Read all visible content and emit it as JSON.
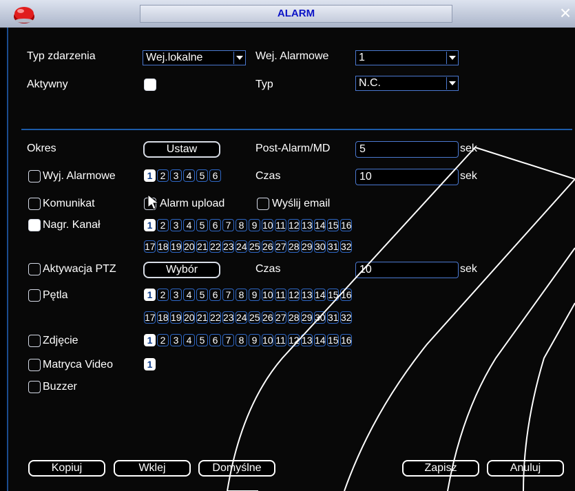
{
  "title": "ALARM",
  "row1": {
    "event_type_label": "Typ zdarzenia",
    "event_type_value": "Wej.lokalne",
    "alarm_input_label": "Wej. Alarmowe",
    "alarm_input_value": "1"
  },
  "row2": {
    "active_label": "Aktywny",
    "type_label": "Typ",
    "type_value": "N.C."
  },
  "period": {
    "label": "Okres",
    "button": "Ustaw",
    "post_alarm_label": "Post-Alarm/MD",
    "post_alarm_value": "5",
    "unit": "sek"
  },
  "alarm_out": {
    "label": "Wyj. Alarmowe",
    "channels": [
      "1",
      "2",
      "3",
      "4",
      "5",
      "6"
    ],
    "active": [
      "1"
    ],
    "time_label": "Czas",
    "time_value": "10",
    "unit": "sek"
  },
  "notification": {
    "label": "Komunikat",
    "upload_label": "Alarm upload",
    "email_label": "Wyślij email"
  },
  "record": {
    "label": "Nagr. Kanał",
    "channels_row1": [
      "1",
      "2",
      "3",
      "4",
      "5",
      "6",
      "7",
      "8",
      "9",
      "10",
      "11",
      "12",
      "13",
      "14",
      "15",
      "16"
    ],
    "channels_row2": [
      "17",
      "18",
      "19",
      "20",
      "21",
      "22",
      "23",
      "24",
      "25",
      "26",
      "27",
      "28",
      "29",
      "30",
      "31",
      "32"
    ],
    "active": [
      "1"
    ]
  },
  "ptz": {
    "label": "Aktywacja PTZ",
    "button": "Wybór",
    "time_label": "Czas",
    "time_value": "10",
    "unit": "sek"
  },
  "tour": {
    "label": "Pętla",
    "channels_row1": [
      "1",
      "2",
      "3",
      "4",
      "5",
      "6",
      "7",
      "8",
      "9",
      "10",
      "11",
      "12",
      "13",
      "14",
      "15",
      "16"
    ],
    "channels_row2": [
      "17",
      "18",
      "19",
      "20",
      "21",
      "22",
      "23",
      "24",
      "25",
      "26",
      "27",
      "28",
      "29",
      "30",
      "31",
      "32"
    ],
    "active": [
      "1"
    ]
  },
  "snapshot": {
    "label": "Zdjęcie",
    "channels": [
      "1",
      "2",
      "3",
      "4",
      "5",
      "6",
      "7",
      "8",
      "9",
      "10",
      "11",
      "12",
      "13",
      "14",
      "15",
      "16"
    ],
    "active": [
      "1"
    ]
  },
  "matrix": {
    "label": "Matryca Video",
    "channels": [
      "1"
    ],
    "active": [
      "1"
    ]
  },
  "buzzer": {
    "label": "Buzzer"
  },
  "buttons": {
    "copy": "Kopiuj",
    "paste": "Wklej",
    "default": "Domyślne",
    "save": "Zapisz",
    "cancel": "Anuluj"
  },
  "icons": {
    "logo": "red-dome-logo-icon",
    "close": "close-icon",
    "cursor": "mouse-cursor-icon"
  }
}
